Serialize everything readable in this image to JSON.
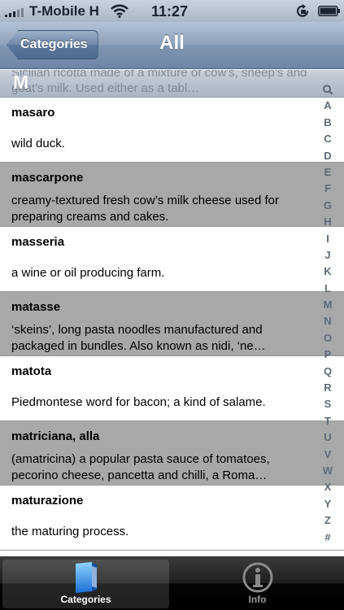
{
  "status_bar": {
    "carrier": "T-Mobile H",
    "time": "11:27",
    "icons": [
      "signal-icon",
      "wifi-icon",
      "rotation-lock-icon",
      "battery-icon"
    ]
  },
  "nav": {
    "back_label": "Categories",
    "title": "All"
  },
  "section": {
    "letter": "M",
    "peek_text": "Sicilian ricotta made of a mixture of cow's, sheep's and goat's milk. Used either as a tabl…"
  },
  "entries": [
    {
      "term": "masaro",
      "definition": "wild duck."
    },
    {
      "term": "mascarpone",
      "definition": "creamy-textured fresh cow’s milk cheese used for preparing creams and cakes."
    },
    {
      "term": "masseria",
      "definition": "a wine or oil producing farm."
    },
    {
      "term": "matasse",
      "definition": "‘skeins’, long pasta noodles manufactured and packaged in bundles. Also known as nidi, ‘ne…"
    },
    {
      "term": "matota",
      "definition": "Piedmontese word for bacon; a kind of salame."
    },
    {
      "term": "matriciana, alla",
      "definition": "(amatricina) a popular pasta sauce of tomatoes, pecorino cheese, pancetta and chilli, a Roma…"
    },
    {
      "term": "maturazione",
      "definition": "the maturing process."
    }
  ],
  "index": [
    "A",
    "B",
    "C",
    "D",
    "E",
    "F",
    "G",
    "H",
    "I",
    "J",
    "K",
    "L",
    "M",
    "N",
    "O",
    "P",
    "Q",
    "R",
    "S",
    "T",
    "U",
    "V",
    "W",
    "X",
    "Y",
    "Z",
    "#"
  ],
  "tabs": [
    {
      "label": "Categories",
      "icon": "categories-icon",
      "selected": true
    },
    {
      "label": "Info",
      "icon": "info-icon",
      "selected": false
    }
  ],
  "colors": {
    "row_alt": "#a8a8a8",
    "nav_blue": "#6e86a6",
    "tab_bar": "#000000"
  }
}
